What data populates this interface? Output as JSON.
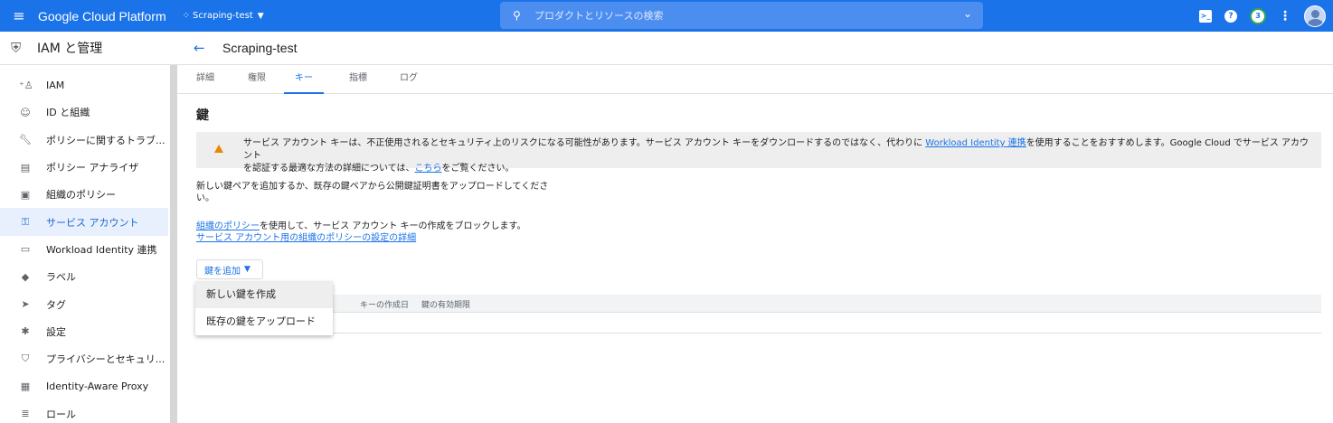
{
  "topbar": {
    "menu_icon": "hamburger-icon",
    "brand": "Google Cloud Platform",
    "project": "Scraping-test",
    "search_placeholder": "プロダクトとリソースの検索",
    "notification_count": "3"
  },
  "sidebar": {
    "title": "IAM と管理",
    "items": [
      {
        "label": "IAM",
        "icon": "person-add-icon"
      },
      {
        "label": "ID と組織",
        "icon": "account-circle-icon"
      },
      {
        "label": "ポリシーに関するトラブ...",
        "icon": "wrench-icon"
      },
      {
        "label": "ポリシー アナライザ",
        "icon": "document-search-icon"
      },
      {
        "label": "組織のポリシー",
        "icon": "list-box-icon"
      },
      {
        "label": "サービス アカウント",
        "icon": "service-account-icon",
        "active": true
      },
      {
        "label": "Workload Identity 連携",
        "icon": "id-card-icon"
      },
      {
        "label": "ラベル",
        "icon": "label-icon"
      },
      {
        "label": "タグ",
        "icon": "tag-icon"
      },
      {
        "label": "設定",
        "icon": "settings-icon"
      },
      {
        "label": "プライバシーとセキュリ...",
        "icon": "shield-icon"
      },
      {
        "label": "Identity-Aware Proxy",
        "icon": "proxy-icon"
      },
      {
        "label": "ロール",
        "icon": "roles-icon"
      }
    ]
  },
  "main": {
    "title": "Scraping-test",
    "tabs": [
      "詳細",
      "権限",
      "キー",
      "指標",
      "ログ"
    ],
    "active_tab": "キー",
    "section_title": "鍵",
    "warning": {
      "text_a": "サービス アカウント キーは、不正使用されるとセキュリティ上のリスクになる可能性があります。サービス アカウント キーをダウンロードするのではなく、代わりに ",
      "link_a": "Workload Identity 連携",
      "text_b": "を使用することをおすすめします。Google Cloud でサービス アカウント",
      "text_c": "を認証する最適な方法の詳細については、",
      "link_b": "こちら",
      "text_d": "をご覧ください。"
    },
    "description": "新しい鍵ペアを追加するか、既存の鍵ペアから公開鍵証明書をアップロードしてください。",
    "policy_link": "組織のポリシー",
    "policy_text": "を使用して、サービス アカウント キーの作成をブロックします。",
    "policy_details_link": "サービス アカウント用の組織のポリシーの設定の詳細",
    "add_key_button": "鍵を追加",
    "table_headers": [
      "キーの作成日",
      "鍵の有効期限"
    ],
    "dropdown_items": [
      "新しい鍵を作成",
      "既存の鍵をアップロード"
    ]
  }
}
